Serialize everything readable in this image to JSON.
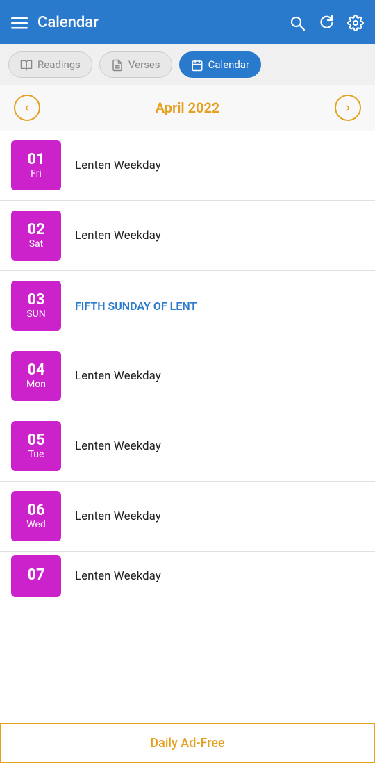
{
  "header": {
    "title": "Calendar",
    "menu_icon": "☰",
    "search_icon": "search",
    "refresh_icon": "refresh",
    "settings_icon": "settings"
  },
  "tabs": [
    {
      "id": "readings",
      "label": "Readings",
      "icon": "book",
      "active": false
    },
    {
      "id": "verses",
      "label": "Verses",
      "icon": "document",
      "active": false
    },
    {
      "id": "calendar",
      "label": "Calendar",
      "icon": "calendar",
      "active": true
    }
  ],
  "month_nav": {
    "title": "April 2022",
    "prev_label": "‹",
    "next_label": "›"
  },
  "calendar_entries": [
    {
      "date_num": "01",
      "date_day": "Fri",
      "event": "Lenten Weekday",
      "sunday": false
    },
    {
      "date_num": "02",
      "date_day": "Sat",
      "event": "Lenten Weekday",
      "sunday": false
    },
    {
      "date_num": "03",
      "date_day": "SUN",
      "event": "FIFTH SUNDAY OF LENT",
      "sunday": true
    },
    {
      "date_num": "04",
      "date_day": "Mon",
      "event": "Lenten Weekday",
      "sunday": false
    },
    {
      "date_num": "05",
      "date_day": "Tue",
      "event": "Lenten Weekday",
      "sunday": false
    },
    {
      "date_num": "06",
      "date_day": "Wed",
      "event": "Lenten Weekday",
      "sunday": false
    },
    {
      "date_num": "07",
      "date_day": "",
      "event": "Lenten Weekday",
      "sunday": false,
      "partial": true
    }
  ],
  "ad_bar": {
    "label": "Daily Ad-Free"
  }
}
